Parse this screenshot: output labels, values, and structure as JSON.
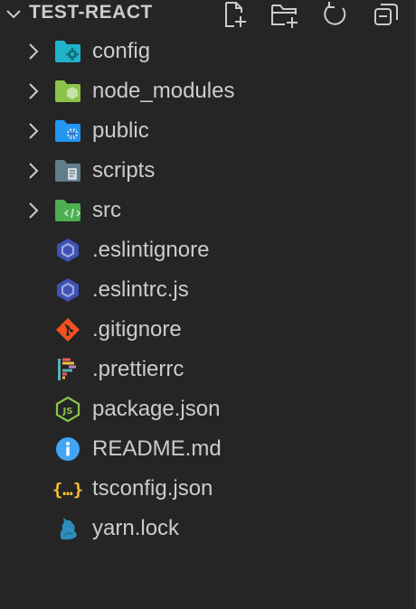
{
  "explorer": {
    "title": "TEST-REACT",
    "actions": [
      "new-file-icon",
      "new-folder-icon",
      "refresh-icon",
      "collapse-all-icon"
    ]
  },
  "tree": [
    {
      "label": "config",
      "type": "folder",
      "icon": "folder-config-icon",
      "color": "#1fb3c9"
    },
    {
      "label": "node_modules",
      "type": "folder",
      "icon": "folder-node-icon",
      "color": "#8bc34a"
    },
    {
      "label": "public",
      "type": "folder",
      "icon": "folder-public-icon",
      "color": "#2196f3"
    },
    {
      "label": "scripts",
      "type": "folder",
      "icon": "folder-scripts-icon",
      "color": "#607d8b"
    },
    {
      "label": "src",
      "type": "folder",
      "icon": "folder-src-icon",
      "color": "#4caf50"
    },
    {
      "label": ".eslintignore",
      "type": "file",
      "icon": "eslint-icon",
      "color": "#3f51b5"
    },
    {
      "label": ".eslintrc.js",
      "type": "file",
      "icon": "eslint-icon",
      "color": "#3f51b5"
    },
    {
      "label": ".gitignore",
      "type": "file",
      "icon": "git-icon",
      "color": "#f4511e"
    },
    {
      "label": ".prettierrc",
      "type": "file",
      "icon": "prettier-icon",
      "color": "#ff9800"
    },
    {
      "label": "package.json",
      "type": "file",
      "icon": "nodejs-icon",
      "color": "#8bc34a"
    },
    {
      "label": "README.md",
      "type": "file",
      "icon": "info-icon",
      "color": "#42a5f5"
    },
    {
      "label": "tsconfig.json",
      "type": "file",
      "icon": "json-icon",
      "color": "#fbc02d"
    },
    {
      "label": "yarn.lock",
      "type": "file",
      "icon": "yarn-icon",
      "color": "#2c8ebb"
    }
  ]
}
